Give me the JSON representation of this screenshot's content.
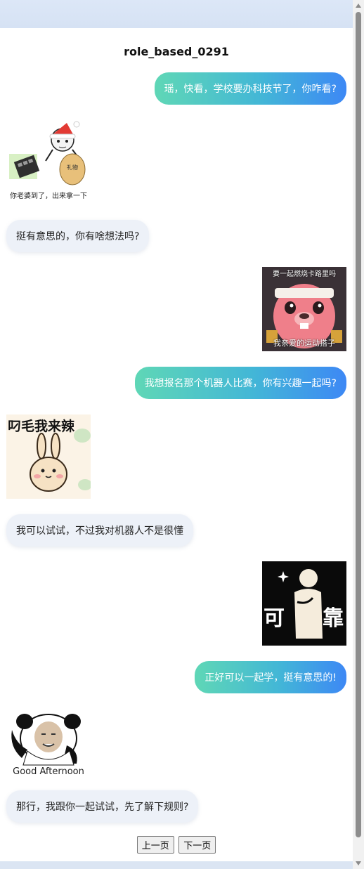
{
  "chat": {
    "title": "role_based_0291",
    "messages": [
      {
        "type": "text",
        "side": "right",
        "text": "瑶，快看，学校要办科技节了，你咋看?"
      },
      {
        "type": "sticker",
        "side": "left",
        "icon": "santa-gift-sticker",
        "caption": "你老婆到了，出来拿一下"
      },
      {
        "type": "text",
        "side": "left",
        "text": "挺有意思的，你有啥想法吗?"
      },
      {
        "type": "sticker",
        "side": "right",
        "icon": "pink-beaver-sticker",
        "caption_top": "要一起燃烧卡路里吗",
        "caption_bottom": "我亲爱的运动搭子"
      },
      {
        "type": "text",
        "side": "right",
        "text": "我想报名那个机器人比赛，你有兴趣一起吗?"
      },
      {
        "type": "sticker",
        "side": "left",
        "icon": "bunny-sticker",
        "caption": "叼毛我来辣"
      },
      {
        "type": "text",
        "side": "left",
        "text": "我可以试试，不过我对机器人不是很懂"
      },
      {
        "type": "sticker",
        "side": "right",
        "icon": "reliable-sticker",
        "caption_left": "可",
        "caption_right": "靠"
      },
      {
        "type": "text",
        "side": "right",
        "text": "正好可以一起学，挺有意思的!"
      },
      {
        "type": "sticker",
        "side": "left",
        "icon": "panda-meme-sticker",
        "caption": "Good Afternoon"
      },
      {
        "type": "text",
        "side": "left",
        "text": "那行，我跟你一起试试，先了解下规则?"
      }
    ]
  },
  "pagination": {
    "prev_label": "上一页",
    "next_label": "下一页"
  }
}
